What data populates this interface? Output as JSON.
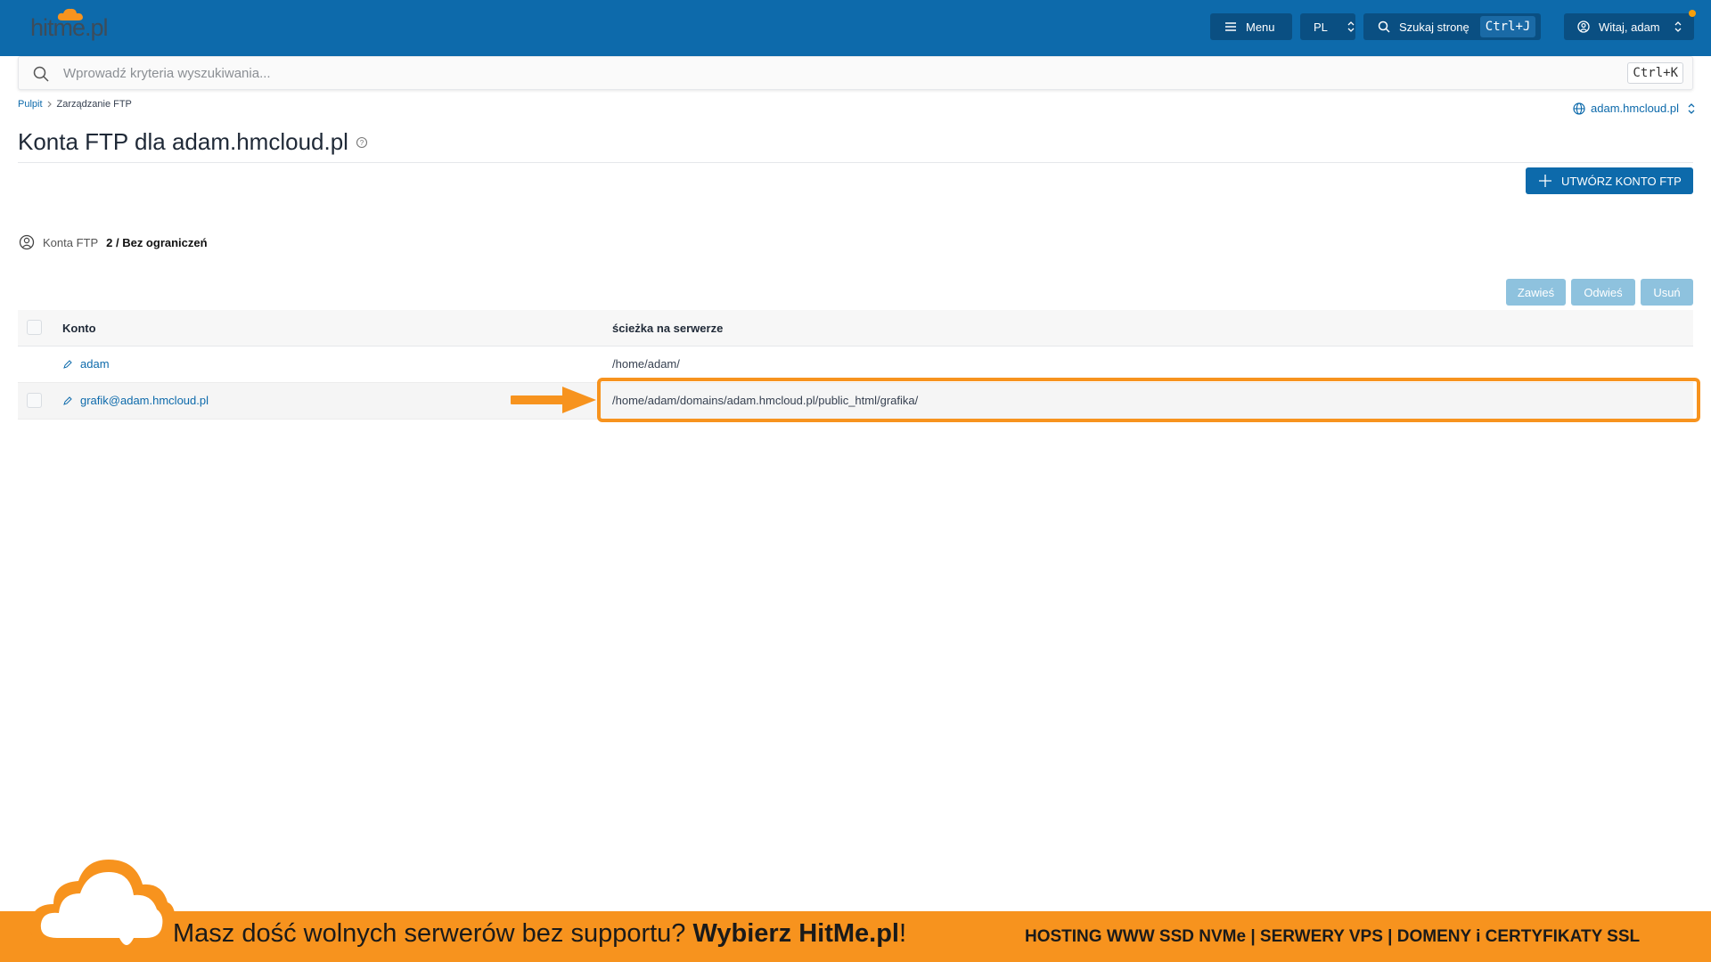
{
  "header": {
    "logo_text": "hitme.pl",
    "menu_label": "Menu",
    "lang_label": "PL",
    "search_label": "Szukaj stronę",
    "search_shortcut": "Ctrl+J",
    "user_label": "Witaj, adam"
  },
  "search": {
    "placeholder": "Wprowadź kryteria wyszukiwania...",
    "shortcut": "Ctrl+K"
  },
  "breadcrumb": {
    "home": "Pulpit",
    "current": "Zarządzanie FTP"
  },
  "domain_selector": "adam.hmcloud.pl",
  "page_title": "Konta FTP dla adam.hmcloud.pl",
  "create_button": "UTWÓRZ KONTO FTP",
  "stats": {
    "label": "Konta FTP",
    "value": "2 / Bez ograniczeń"
  },
  "actions": {
    "suspend": "Zawieś",
    "unsuspend": "Odwieś",
    "delete": "Usuń"
  },
  "table": {
    "headers": [
      "Konto",
      "ścieżka na serwerze"
    ],
    "rows": [
      {
        "account": "adam",
        "path": "/home/adam/"
      },
      {
        "account": "grafik@adam.hmcloud.pl",
        "path": "/home/adam/domains/adam.hmcloud.pl/public_html/grafika/"
      }
    ]
  },
  "banner": {
    "left_text": "Masz dość wolnych serwerów bez supportu?",
    "left_bold": "Wybierz HitMe.pl",
    "left_end": "!",
    "right_text": "HOSTING WWW SSD NVMe | SERWERY VPS | DOMENY i CERTYFIKATY SSL"
  },
  "colors": {
    "primary": "#0d6aab",
    "accent": "#f7931e",
    "disabled_button": "#8ec2de"
  }
}
